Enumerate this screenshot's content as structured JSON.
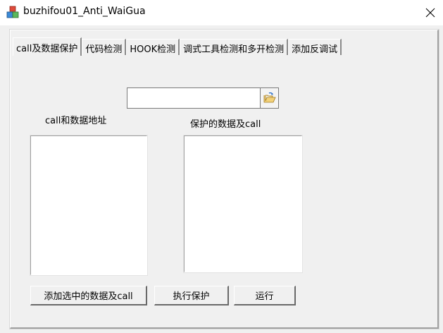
{
  "window": {
    "title": "buzhifou01_Anti_WaiGua",
    "icon": "cubes-app-icon",
    "close_icon": "close-icon"
  },
  "tabs": [
    {
      "label": "call及数据保护",
      "active": true
    },
    {
      "label": "代码检测",
      "active": false
    },
    {
      "label": "HOOK检测",
      "active": false
    },
    {
      "label": "调式工具检测和多开检测",
      "active": false
    },
    {
      "label": "添加反调试",
      "active": false
    }
  ],
  "main": {
    "path_input": {
      "value": "",
      "placeholder": ""
    },
    "browse_icon": "folder-open-icon",
    "left_list_label": "call和数据地址",
    "right_list_label": "保护的数据及call",
    "buttons": {
      "add_selected": "添加选中的数据及call",
      "execute_protect": "执行保护",
      "run": "运行"
    }
  },
  "colors": {
    "window_bg": "#f0f0f0",
    "titlebar_bg": "#ffffff",
    "list_bg": "#ffffff"
  }
}
